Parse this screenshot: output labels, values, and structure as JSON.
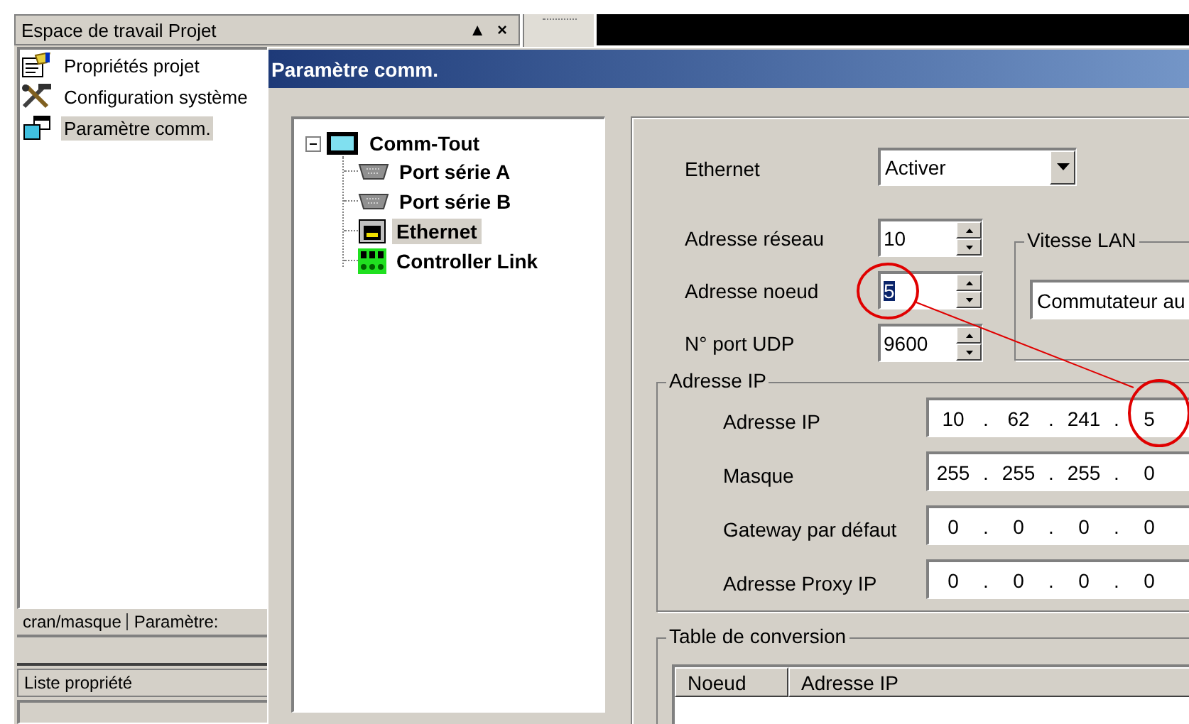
{
  "workspace": {
    "title": "Espace de travail Projet",
    "buttons": [
      "▲",
      "×"
    ],
    "items": [
      {
        "label": "Propriétés projet",
        "kind": "project",
        "selected": false
      },
      {
        "label": "Configuration système",
        "kind": "tools",
        "selected": false
      },
      {
        "label": "Paramètre comm.",
        "kind": "comm",
        "selected": true
      }
    ],
    "tabs": [
      "cran/masque",
      "Paramètre:"
    ]
  },
  "property_list": {
    "title": "Liste propriété"
  },
  "dialog": {
    "title": "Paramètre comm.",
    "tree": {
      "label": "Comm-Tout",
      "expanded": true,
      "children": [
        {
          "label": "Port série A",
          "kind": "serial",
          "selected": false
        },
        {
          "label": "Port série B",
          "kind": "serial",
          "selected": false
        },
        {
          "label": "Ethernet",
          "kind": "ethernet",
          "selected": true
        },
        {
          "label": "Controller Link",
          "kind": "link",
          "selected": false
        }
      ]
    },
    "ethernet": {
      "label": "Ethernet",
      "value": "Activer"
    },
    "spin_fields": [
      {
        "label": "Adresse réseau",
        "value": "10",
        "highlighted": false
      },
      {
        "label": "Adresse noeud",
        "value": "5",
        "highlighted": true
      },
      {
        "label": "N° port UDP",
        "value": "9600",
        "highlighted": false
      }
    ],
    "lan_speed": {
      "title": "Vitesse LAN",
      "value": "Commutateur au"
    },
    "ip_group": {
      "title": "Adresse IP",
      "separator": ".",
      "rows": [
        {
          "label": "Adresse IP",
          "octets": [
            "10",
            "62",
            "241",
            "5"
          ]
        },
        {
          "label": "Masque",
          "octets": [
            "255",
            "255",
            "255",
            "0"
          ]
        },
        {
          "label": "Gateway par défaut",
          "octets": [
            "0",
            "0",
            "0",
            "0"
          ]
        },
        {
          "label": "Adresse Proxy IP",
          "octets": [
            "0",
            "0",
            "0",
            "0"
          ]
        }
      ]
    },
    "conversion_table": {
      "title": "Table de conversion",
      "columns": [
        "Noeud",
        "Adresse IP"
      ]
    }
  }
}
